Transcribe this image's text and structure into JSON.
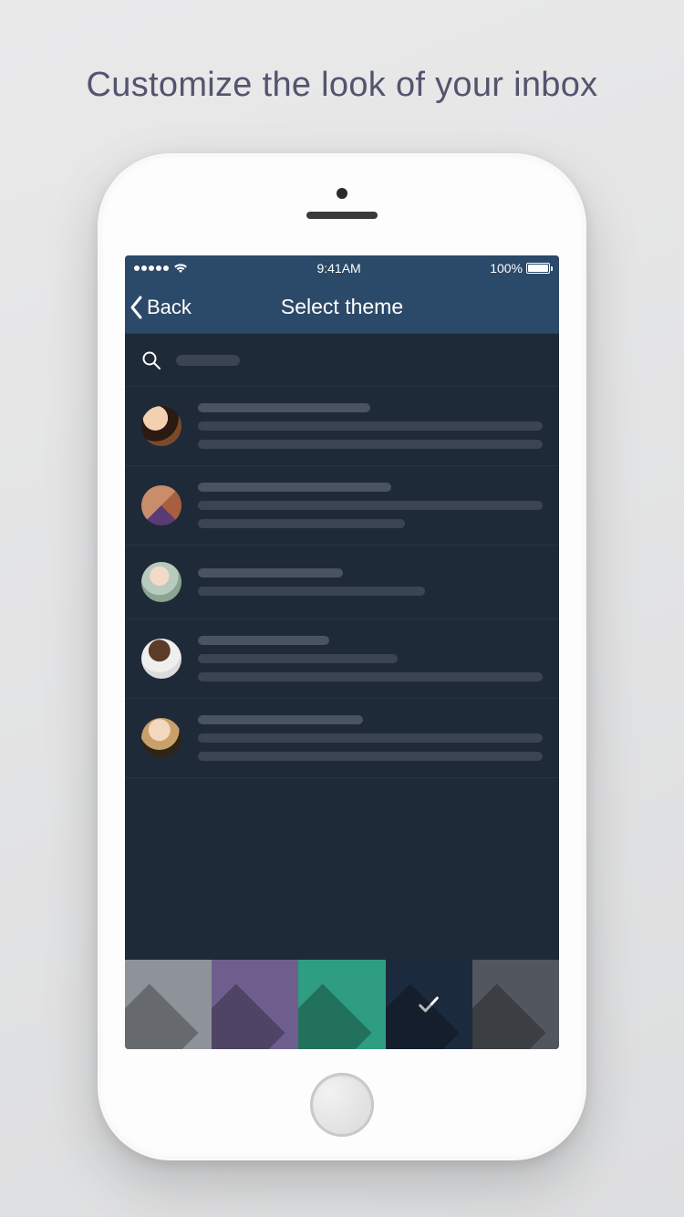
{
  "marketing": {
    "headline": "Customize the look of your inbox"
  },
  "status_bar": {
    "time": "9:41AM",
    "battery_pct": "100%"
  },
  "nav": {
    "back_label": "Back",
    "title": "Select theme"
  },
  "theme_swatches": [
    {
      "name": "grey",
      "color": "#8e9399",
      "selected": false
    },
    {
      "name": "purple",
      "color": "#6e5e8e",
      "selected": false
    },
    {
      "name": "teal",
      "color": "#2f9d82",
      "selected": false
    },
    {
      "name": "navy",
      "color": "#1c2a3e",
      "selected": true
    },
    {
      "name": "slate",
      "color": "#52575d",
      "selected": false
    }
  ]
}
